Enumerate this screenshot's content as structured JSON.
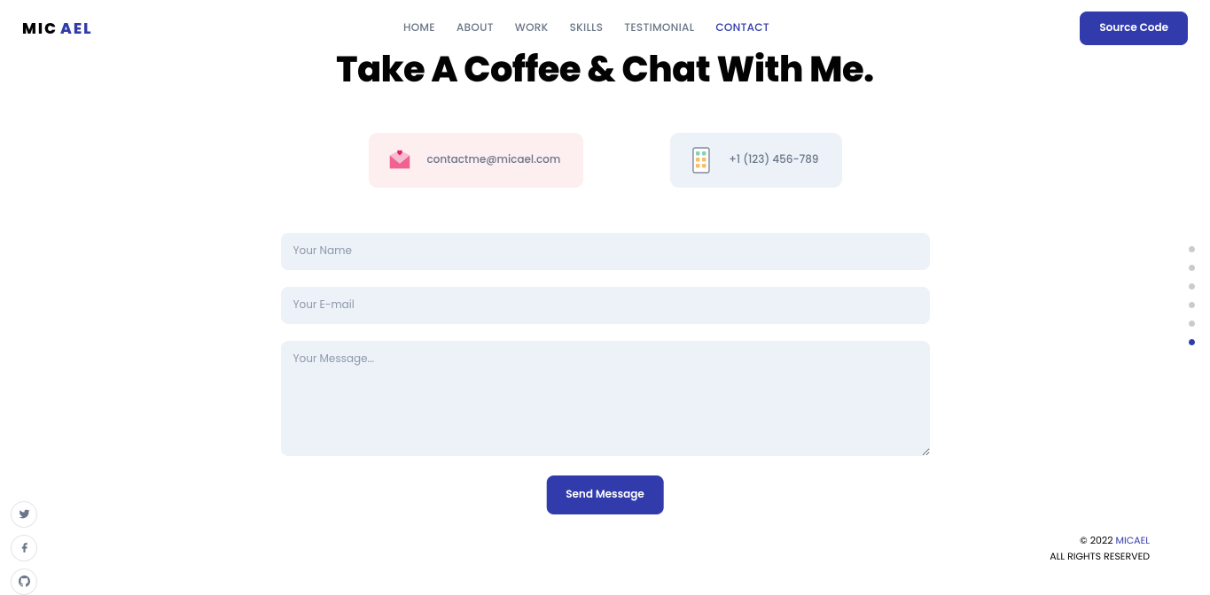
{
  "logo": {
    "partA": "MIC",
    "partB": "AEL"
  },
  "nav": {
    "items": [
      {
        "label": "HOME"
      },
      {
        "label": "ABOUT"
      },
      {
        "label": "WORK"
      },
      {
        "label": "SKILLS"
      },
      {
        "label": "TESTIMONIAL"
      },
      {
        "label": "CONTACT"
      }
    ],
    "active_index": 5
  },
  "source_button": "Source Code",
  "heading": "Take A Coffee & Chat With Me.",
  "contact_email": "contactme@micael.com",
  "contact_phone": "+1 (123) 456-789",
  "form": {
    "name_placeholder": "Your Name",
    "email_placeholder": "Your E-mail",
    "message_placeholder": "Your Message...",
    "submit_label": "Send Message"
  },
  "footer": {
    "line1_prefix": "© 2022 ",
    "line1_brand": "MICAEL",
    "line2": "ALL RIGHTS RESERVED"
  },
  "dots_count": 6,
  "dots_active": 5,
  "colors": {
    "accent": "#313bac",
    "input_bg": "#edf2f8",
    "email_bg": "#fdeef0"
  }
}
